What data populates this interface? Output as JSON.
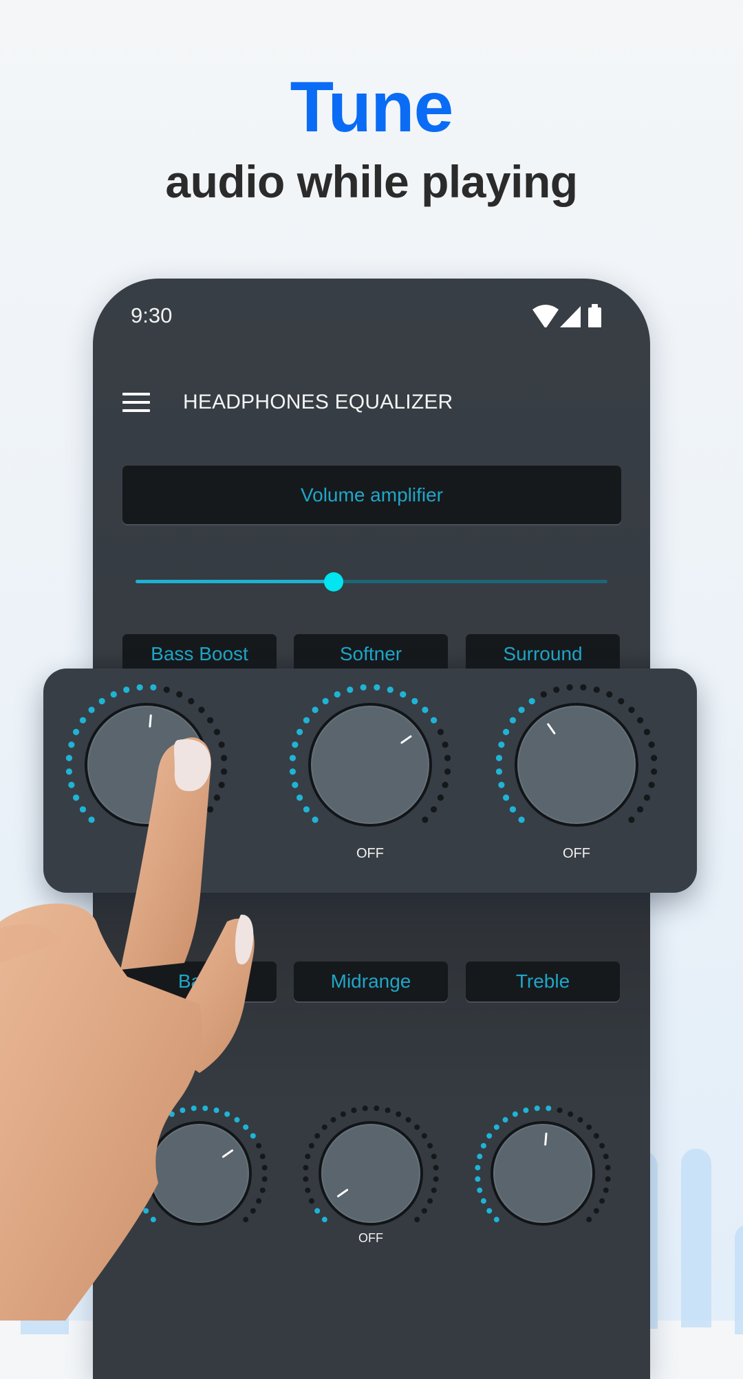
{
  "promo": {
    "headline": "Tune",
    "subheadline": "audio while playing",
    "headline_color": "#0a6cf5"
  },
  "status_bar": {
    "time": "9:30",
    "icons": [
      "wifi-icon",
      "cellular-signal-icon",
      "battery-icon"
    ]
  },
  "app_bar": {
    "menu_icon": "hamburger-menu-icon",
    "title": "HEADPHONES EQUALIZER"
  },
  "volume": {
    "label": "Volume amplifier",
    "slider_value_percent": 42
  },
  "effects_row": [
    {
      "label": "Bass Boost"
    },
    {
      "label": "Softner"
    },
    {
      "label": "Surround"
    }
  ],
  "effects_knobs": [
    {
      "name": "bass-boost",
      "active_dots": 15,
      "total_dots": 28,
      "status": ""
    },
    {
      "name": "softner",
      "active_dots": 20,
      "total_dots": 28,
      "status": "OFF"
    },
    {
      "name": "surround",
      "active_dots": 11,
      "total_dots": 28,
      "status": "OFF"
    }
  ],
  "tone_row": [
    {
      "label": "Bass"
    },
    {
      "label": "Midrange"
    },
    {
      "label": "Treble"
    }
  ],
  "tone_knobs": [
    {
      "name": "bass",
      "active_dots": 20,
      "total_dots": 28,
      "status": ""
    },
    {
      "name": "midrange",
      "active_dots": 2,
      "total_dots": 28,
      "status": "OFF"
    },
    {
      "name": "treble",
      "active_dots": 15,
      "total_dots": 28,
      "status": ""
    }
  ],
  "colors": {
    "accent": "#1fb4d6",
    "dot_inactive": "#15181b",
    "knob_face": "#5a656d",
    "phone_bg": "#363c42",
    "button_bg": "#16191c"
  }
}
